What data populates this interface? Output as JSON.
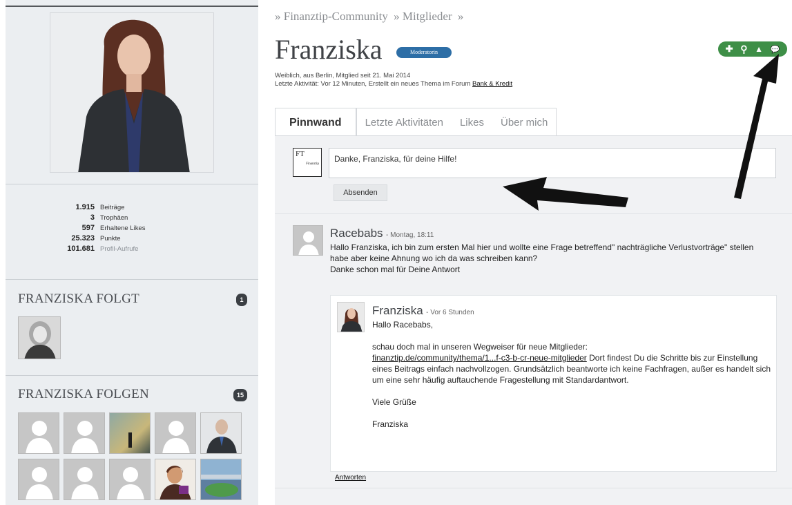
{
  "breadcrumb": [
    "» Finanztip-Community",
    "» Mitglieder",
    "»"
  ],
  "profile": {
    "name": "Franziska",
    "role": "Moderatorin",
    "meta_line1": "Weiblich, aus Berlin, Mitglied seit 21. Mai 2014",
    "meta_line2_prefix": "Letzte Aktivität: Vor 12 Minuten, Erstellt ein neues Thema im Forum ",
    "meta_forum_link": "Bank & Kredit"
  },
  "stats": [
    {
      "value": "1.915",
      "label": "Beiträge"
    },
    {
      "value": "3",
      "label": "Trophäen"
    },
    {
      "value": "597",
      "label": "Erhaltene Likes"
    },
    {
      "value": "25.323",
      "label": "Punkte"
    },
    {
      "value": "101.681",
      "label": "Profil-Aufrufe"
    }
  ],
  "follows": {
    "title": "FRANZISKA FOLGT",
    "count": "1"
  },
  "followers": {
    "title": "FRANZISKA FOLGEN",
    "count": "15"
  },
  "actions": {
    "icons": [
      "plus-icon",
      "search-icon",
      "warning-icon",
      "chat-icon"
    ],
    "glyphs": [
      "✚",
      "⚲",
      "▲",
      "💬"
    ]
  },
  "tabs": [
    "Pinnwand",
    "Letzte Aktivitäten",
    "Likes",
    "Über mich"
  ],
  "composer": {
    "logo_text": "FT",
    "logo_sub": "Finanztip",
    "value": "Danke, Franziska, für deine Hilfe!",
    "send_label": "Absenden"
  },
  "post": {
    "author": "Racebabs",
    "time": "- Montag, 18:11",
    "text": "Hallo Franziska, ich bin zum ersten Mal hier und wollte eine Frage betreffend\" nachträgliche Verlustvorträge\" stellen habe aber keine Ahnung wo ich da was schreiben kann?",
    "text2": "Danke schon mal für Deine Antwort"
  },
  "reply": {
    "author": "Franziska",
    "time": "- Vor 6 Stunden",
    "greeting": "Hallo Racebabs,",
    "intro": "schau doch mal in unseren Wegweiser für neue Mitglieder:",
    "link": "finanztip.de/community/thema/1...f-c3-b-cr-neue-mitglieder",
    "body": " Dort findest Du die Schritte bis zur Einstellung eines Beitrags einfach nachvollzogen. Grundsätzlich beantworte ich keine Fachfragen, außer es handelt sich um eine sehr häufig auftauchende Fragestellung mit Standardantwort.",
    "closing": "Viele Grüße",
    "signature": "Franziska"
  },
  "reply_link_label": "Antworten",
  "colors": {
    "sidebar": "#ebeef1",
    "action_green": "#3e8f47",
    "role_blue": "#2d6ea6",
    "wall": "#f1f2f4"
  }
}
